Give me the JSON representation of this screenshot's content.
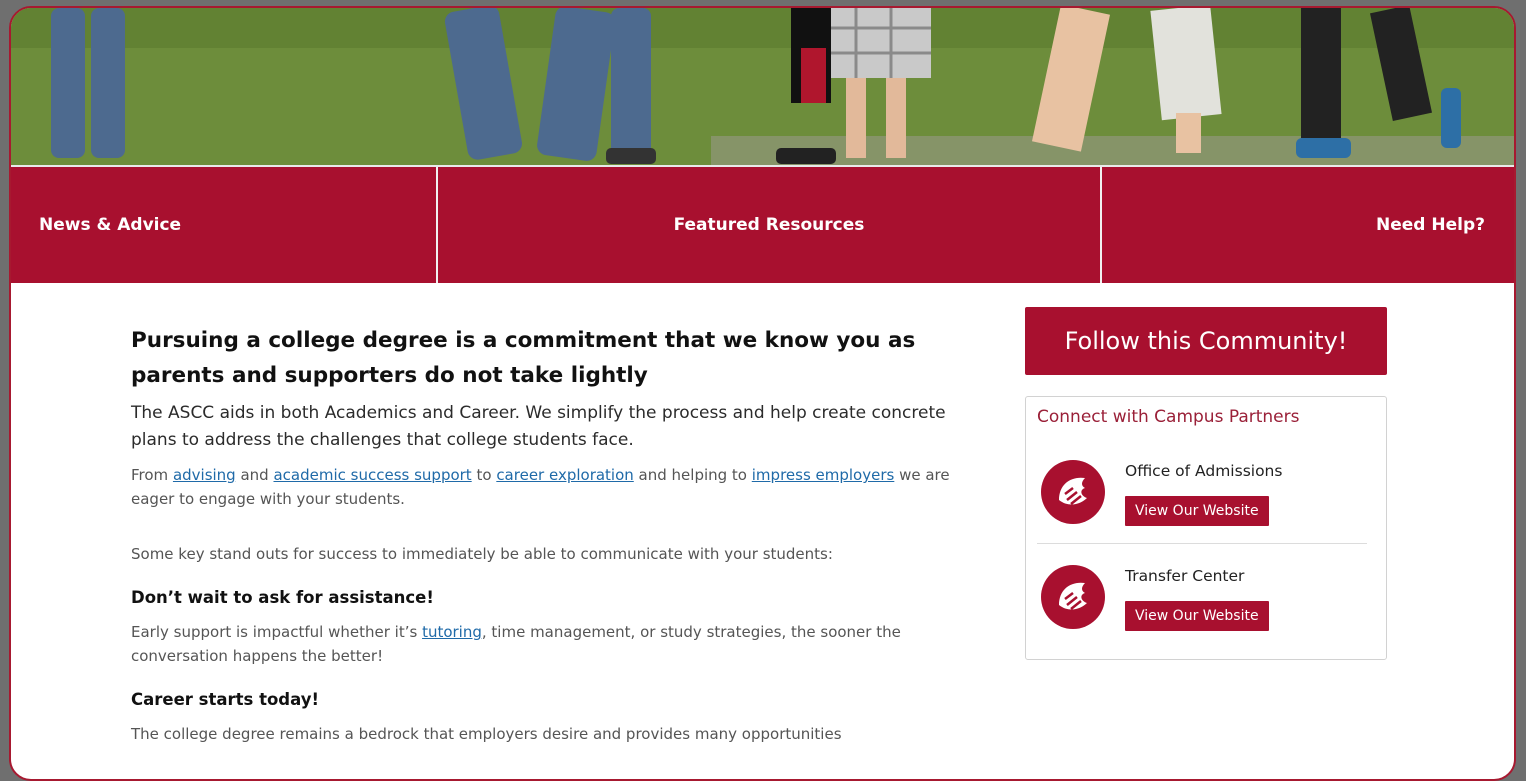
{
  "tabs": {
    "news": "News & Advice",
    "featured": "Featured Resources",
    "help": "Need Help?"
  },
  "main": {
    "heading": "Pursuing a college degree is a commitment that we know you as parents and supporters do not take lightly",
    "lead": "The ASCC aids in both Academics and Career. We simplify the process and help create concrete plans to address the challenges that college students face.",
    "para1": {
      "t1": "From ",
      "link_advising": "advising",
      "t2": " and ",
      "link_success": "academic success support",
      "t3": " to ",
      "link_career": "career exploration",
      "t4": " and helping to ",
      "link_employers": "impress employers",
      "t5": " we are eager to engage with your students."
    },
    "para2": "Some key stand outs for success to immediately be able to communicate with your students:",
    "section1": {
      "heading": "Don’t wait to ask for assistance!",
      "t1": "Early support is impactful whether it’s ",
      "link_tutoring": "tutoring",
      "t2": ", time management, or study strategies, the sooner the conversation happens the better!"
    },
    "section2": {
      "heading": "Career starts today!",
      "text": "The college degree remains a bedrock that employers desire and provides many opportunities"
    }
  },
  "sidebar": {
    "follow_label": "Follow this Community!",
    "partners_title": "Connect with Campus Partners",
    "partners": [
      {
        "name": "Office of Admissions",
        "button": "View Our Website"
      },
      {
        "name": "Transfer Center",
        "button": "View Our Website"
      }
    ]
  },
  "colors": {
    "crimson": "#a8102f",
    "link": "#1f6aa8"
  }
}
